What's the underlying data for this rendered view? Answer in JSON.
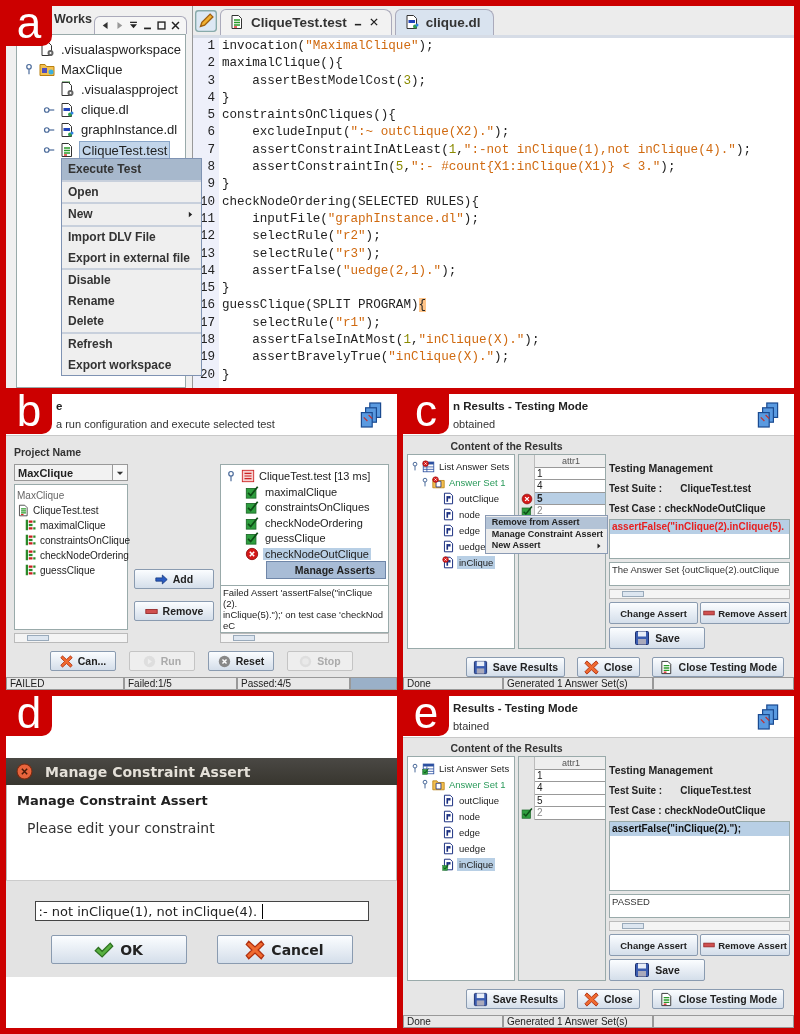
{
  "panel_a": {
    "label": "a",
    "workspace_tab": "Works",
    "workspace_tree": [
      {
        "label": ".visualaspworkspace",
        "kind": "settings_file",
        "selected": false
      },
      {
        "label": "MaxClique",
        "kind": "project",
        "selected": false,
        "expanded": true,
        "children": [
          {
            "label": ".visualaspproject",
            "kind": "xml_file",
            "selected": false
          },
          {
            "label": "clique.dl",
            "kind": "dlv_file",
            "selected": false,
            "expanded": false
          },
          {
            "label": "graphInstance.dl",
            "kind": "dlv_file",
            "selected": false,
            "expanded": false
          },
          {
            "label": "CliqueTest.test",
            "kind": "test_file",
            "selected": true,
            "expanded": false
          }
        ]
      }
    ],
    "context_menu": [
      {
        "items": [
          {
            "label": "Execute Test",
            "selected": true,
            "submenu": false
          }
        ]
      },
      {
        "items": [
          {
            "label": "Open",
            "selected": false,
            "submenu": false
          }
        ]
      },
      {
        "items": [
          {
            "label": "New",
            "selected": false,
            "submenu": true
          }
        ]
      },
      {
        "items": [
          {
            "label": "Import DLV File",
            "selected": false,
            "submenu": false
          },
          {
            "label": "Export in external file",
            "selected": false,
            "submenu": false
          }
        ]
      },
      {
        "items": [
          {
            "label": "Disable",
            "selected": false,
            "submenu": false
          },
          {
            "label": "Rename",
            "selected": false,
            "submenu": false
          },
          {
            "label": "Delete",
            "selected": false,
            "submenu": false
          }
        ]
      },
      {
        "items": [
          {
            "label": "Refresh",
            "selected": false,
            "submenu": false
          },
          {
            "label": "Export workspace",
            "selected": false,
            "submenu": false
          }
        ]
      }
    ],
    "editor_tabs": [
      {
        "label": "CliqueTest.test",
        "kind": "test_file",
        "selected": true
      },
      {
        "label": "clique.dl",
        "kind": "dlv_file",
        "selected": false
      }
    ],
    "code_lines": [
      {
        "number": "1",
        "text": "invocation(\"MaximalClique\");",
        "bracket_highlight": false
      },
      {
        "number": "2",
        "text": "maximalClique(){",
        "bracket_highlight": false
      },
      {
        "number": "3",
        "text": "    assertBestModelCost(3);",
        "bracket_highlight": false
      },
      {
        "number": "4",
        "text": "}",
        "bracket_highlight": false
      },
      {
        "number": "5",
        "text": "constraintsOnCliques(){",
        "bracket_highlight": false
      },
      {
        "number": "6",
        "text": "    excludeInput(\":~ outClique(X2).\");",
        "bracket_highlight": false
      },
      {
        "number": "7",
        "text": "    assertConstraintInAtLeast(1,\":-not inClique(1),not inClique(4).\");",
        "bracket_highlight": false
      },
      {
        "number": "8",
        "text": "    assertConstraintIn(5,\":- #count{X1:inClique(X1)} < 3.\");",
        "bracket_highlight": false
      },
      {
        "number": "9",
        "text": "}",
        "bracket_highlight": false
      },
      {
        "number": "10",
        "text": "checkNodeOrdering(SELECTED RULES){",
        "bracket_highlight": false
      },
      {
        "number": "11",
        "text": "    inputFile(\"graphInstance.dl\");",
        "bracket_highlight": false
      },
      {
        "number": "12",
        "text": "    selectRule(\"r2\");",
        "bracket_highlight": false
      },
      {
        "number": "13",
        "text": "    selectRule(\"r3\");",
        "bracket_highlight": false
      },
      {
        "number": "14",
        "text": "    assertFalse(\"uedge(2,1).\");",
        "bracket_highlight": false
      },
      {
        "number": "15",
        "text": "}",
        "bracket_highlight": false
      },
      {
        "number": "16",
        "text": "guessClique(SPLIT PROGRAM){",
        "bracket_highlight": true
      },
      {
        "number": "17",
        "text": "    selectRule(\"r1\");",
        "bracket_highlight": false
      },
      {
        "number": "18",
        "text": "    assertFalseInAtMost(1,\"inClique(X).\");",
        "bracket_highlight": false
      },
      {
        "number": "19",
        "text": "    assertBravelyTrue(\"inClique(X).\");",
        "bracket_highlight": false
      },
      {
        "number": "20",
        "text": "}",
        "bracket_highlight": false
      }
    ]
  },
  "panel_b": {
    "label": "b",
    "title": "e",
    "subtitle": "a run configuration and execute selected test",
    "project_label": "Project Name",
    "project_select": "MaxClique",
    "project_tree": {
      "root": "MaxClique",
      "file": "CliqueTest.test",
      "test_cases": [
        "maximalClique",
        "constraintsOnClique",
        "checkNodeOrdering",
        "guessClique"
      ]
    },
    "middle_buttons": [
      {
        "label": "Add",
        "kind": "add"
      },
      {
        "label": "Remove",
        "kind": "remove"
      }
    ],
    "results_tree": {
      "label": "CliqueTest.test [13 ms]",
      "failed": true,
      "expanded": true,
      "children": [
        {
          "label": "maximalClique",
          "passed": true,
          "selected": false
        },
        {
          "label": "constraintsOnCliques",
          "passed": true,
          "selected": false
        },
        {
          "label": "checkNodeOrdering",
          "passed": true,
          "selected": false
        },
        {
          "label": "guessClique",
          "passed": true,
          "selected": false
        },
        {
          "label": "checkNodeOutClique",
          "passed": false,
          "selected": true
        }
      ]
    },
    "popup_menu": [
      {
        "label": "Manage Asserts",
        "selected": true
      }
    ],
    "message_lines": [
      "Failed Assert 'assertFalse(\"inClique(2).",
      "inClique(5).\");' on test case 'checkNodeC"
    ],
    "buttons": [
      {
        "label": "Can...",
        "kind": "cancel",
        "disabled": false
      },
      {
        "label": "Run",
        "kind": "run",
        "disabled": true
      },
      {
        "label": "Reset",
        "kind": "reset",
        "disabled": false
      },
      {
        "label": "Stop",
        "kind": "stop",
        "disabled": true
      }
    ],
    "status_bar": [
      "FAILED",
      "Failed:1/5",
      "Passed:4/5"
    ],
    "progress_bar": {
      "level": 1
    }
  },
  "panel_c": {
    "label": "c",
    "title": "n Results - Testing Mode",
    "subtitle": "obtained",
    "content_title": "Content of the Results",
    "answer_tree": [
      {
        "label": "List Answer Sets",
        "kind": "answer_set_list",
        "failed": true,
        "passed": false,
        "selected": false,
        "expanded": true,
        "children": [
          {
            "label": "Answer Set 1",
            "kind": "answer_set",
            "failed": true,
            "passed": false,
            "selected": false,
            "expanded": true,
            "children": [
              {
                "label": "outClique",
                "kind": "predicate",
                "failed": false,
                "passed": false,
                "selected": false
              },
              {
                "label": "node",
                "kind": "predicate",
                "failed": false,
                "passed": false,
                "selected": false
              },
              {
                "label": "edge",
                "kind": "predicate",
                "failed": false,
                "passed": false,
                "selected": false
              },
              {
                "label": "uedge",
                "kind": "predicate",
                "failed": false,
                "passed": false,
                "selected": false
              },
              {
                "label": "inClique",
                "kind": "predicate",
                "failed": true,
                "passed": false,
                "selected": true
              }
            ]
          }
        ]
      }
    ],
    "table": {
      "columns": [
        "attr1"
      ],
      "rows": [
        {
          "value": "1",
          "failed": false,
          "passed": false,
          "selected": false
        },
        {
          "value": "4",
          "failed": false,
          "passed": false,
          "selected": false
        },
        {
          "value": "5",
          "failed": true,
          "passed": false,
          "selected": true
        },
        {
          "value": "2",
          "failed": false,
          "passed": true,
          "selected": false
        }
      ]
    },
    "context_menu": [
      {
        "label": "Remove from Assert",
        "selected": true,
        "submenu": false
      },
      {
        "label": "Manage Constraint Assert",
        "selected": false,
        "submenu": false
      },
      {
        "label": "New Assert",
        "selected": false,
        "submenu": true
      }
    ],
    "management_title": "Testing Management",
    "test_suite_label": "Test Suite :",
    "test_suite": "CliqueTest.test",
    "test_case": "Test Case : checkNodeOutClique",
    "asserts": [
      {
        "text": "assertFalse(\"inClique(2).inClique(5).",
        "failed": true,
        "selected": true
      }
    ],
    "result_text": "The Answer Set {outClique(2).outClique",
    "assert_buttons": [
      {
        "label": "Change Assert",
        "kind": "change"
      },
      {
        "label": "Remove Assert",
        "kind": "remove"
      }
    ],
    "save_button": {
      "label": "Save",
      "kind": "save"
    },
    "bottom_buttons": [
      {
        "label": "Save Results",
        "kind": "save"
      },
      {
        "label": "Close",
        "kind": "close"
      },
      {
        "label": "Close Testing Mode",
        "kind": "close_mode"
      }
    ],
    "status_bar": [
      "Done",
      "Generated 1 Answer Set(s)"
    ]
  },
  "panel_d": {
    "label": "d",
    "dialog_title": "Manage Constraint Assert",
    "heading": "Manage Constraint Assert",
    "message": "Please edit your constraint",
    "constraint_value": ":- not inClique(1), not inClique(4).",
    "buttons": [
      {
        "label": "OK",
        "kind": "ok"
      },
      {
        "label": "Cancel",
        "kind": "cancel"
      }
    ]
  },
  "panel_e": {
    "label": "e",
    "title": "Results - Testing Mode",
    "subtitle": "btained",
    "content_title": "Content of the Results",
    "answer_tree": [
      {
        "label": "List Answer Sets",
        "kind": "answer_set_list",
        "failed": false,
        "passed": true,
        "selected": false,
        "expanded": true,
        "children": [
          {
            "label": "Answer Set 1",
            "kind": "answer_set",
            "failed": false,
            "passed": false,
            "selected": false,
            "expanded": true,
            "children": [
              {
                "label": "outClique",
                "kind": "predicate",
                "failed": false,
                "passed": false,
                "selected": false
              },
              {
                "label": "node",
                "kind": "predicate",
                "failed": false,
                "passed": false,
                "selected": false
              },
              {
                "label": "edge",
                "kind": "predicate",
                "failed": false,
                "passed": false,
                "selected": false
              },
              {
                "label": "uedge",
                "kind": "predicate",
                "failed": false,
                "passed": false,
                "selected": false
              },
              {
                "label": "inClique",
                "kind": "predicate",
                "failed": false,
                "passed": true,
                "selected": true
              }
            ]
          }
        ]
      }
    ],
    "table": {
      "columns": [
        "attr1"
      ],
      "rows": [
        {
          "value": "1",
          "failed": false,
          "passed": false,
          "selected": false
        },
        {
          "value": "4",
          "failed": false,
          "passed": false,
          "selected": false
        },
        {
          "value": "5",
          "failed": false,
          "passed": false,
          "selected": false
        },
        {
          "value": "2",
          "failed": false,
          "passed": true,
          "selected": false
        }
      ]
    },
    "management_title": "Testing Management",
    "test_suite_label": "Test Suite :",
    "test_suite": "CliqueTest.test",
    "test_case": "Test Case : checkNodeOutClique",
    "asserts": [
      {
        "text": "assertFalse(\"inClique(2).\");",
        "failed": false,
        "selected": true
      }
    ],
    "result_text": "PASSED",
    "assert_buttons": [
      {
        "label": "Change Assert",
        "kind": "change"
      },
      {
        "label": "Remove Assert",
        "kind": "remove"
      }
    ],
    "save_button": {
      "label": "Save",
      "kind": "save"
    },
    "bottom_buttons": [
      {
        "label": "Save Results",
        "kind": "save"
      },
      {
        "label": "Close",
        "kind": "close"
      },
      {
        "label": "Close Testing Mode",
        "kind": "close_mode"
      }
    ],
    "status_bar": [
      "Done",
      "Generated 1 Answer Set(s)"
    ]
  }
}
